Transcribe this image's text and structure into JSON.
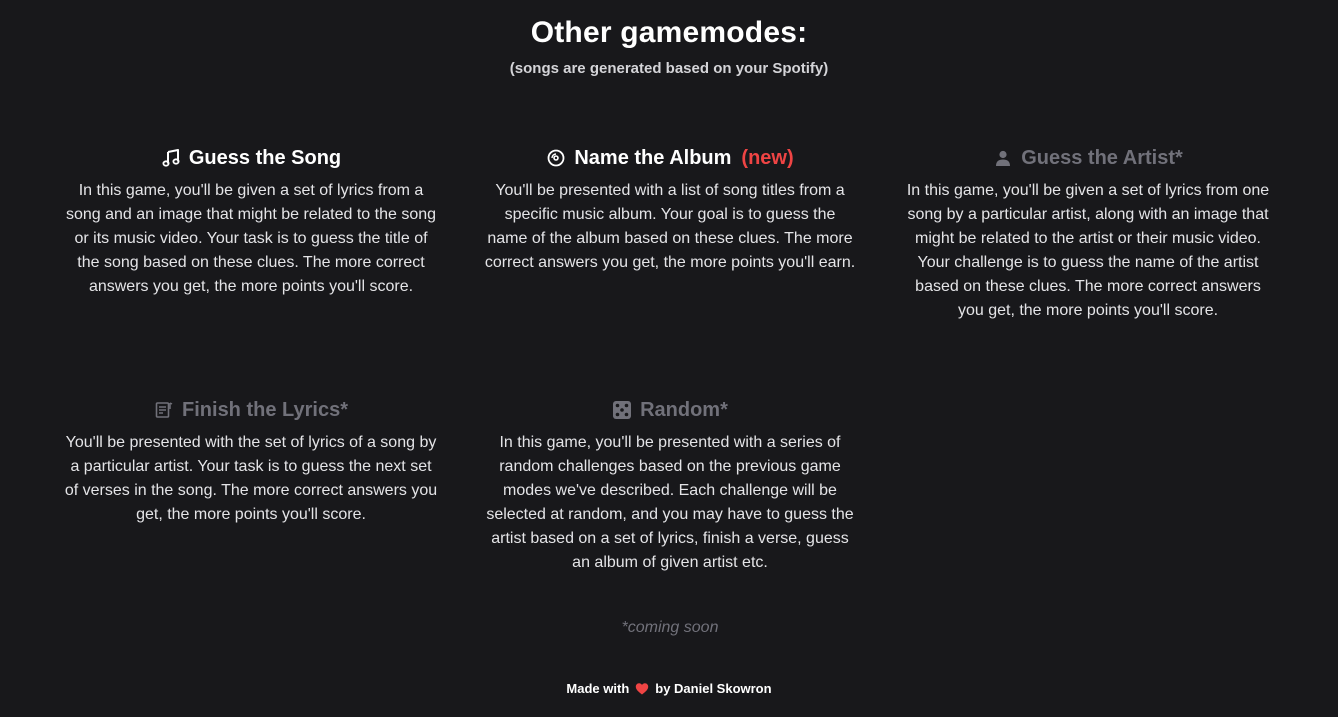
{
  "header": {
    "title": "Other gamemodes:",
    "subtitle": "(songs are generated based on your Spotify)"
  },
  "modes": [
    {
      "title": "Guess the Song",
      "icon": "music-note-icon",
      "description": "In this game, you'll be given a set of lyrics from a song and an image that might be related to the song or its music video. Your task is to guess the title of the song based on these clues. The more correct answers you get, the more points you'll score."
    },
    {
      "title": "Name the Album",
      "badge": "(new)",
      "icon": "album-disc-icon",
      "description": "You'll be presented with a list of song titles from a specific music album. Your goal is to guess the name of the album based on these clues. The more correct answers you get, the more points you'll earn."
    },
    {
      "title": "Guess the Artist*",
      "icon": "person-icon",
      "description": "In this game, you'll be given a set of lyrics from one song by a particular artist, along with an image that might be related to the artist or their music video. Your challenge is to guess the name of the artist based on these clues. The more correct answers you get, the more points you'll score."
    },
    {
      "title": "Finish the Lyrics*",
      "icon": "lyrics-sheet-icon",
      "description": "You'll be presented with the set of lyrics of a song by a particular artist. Your task is to guess the next set of verses in the song. The more correct answers you get, the more points you'll score."
    },
    {
      "title": "Random*",
      "icon": "dice-icon",
      "description": "In this game, you'll be presented with a series of random challenges based on the previous game modes we've described. Each challenge will be selected at random, and you may have to guess the artist based on a set of lyrics, finish a verse, guess an album of given artist etc."
    }
  ],
  "note": "*coming soon",
  "footer": {
    "made_with": "Made with",
    "by": "by Daniel Skowron"
  },
  "colors": {
    "background": "#18181b",
    "accent_new": "#ef4444",
    "disabled": "#71717a",
    "heart": "#ef4444"
  }
}
